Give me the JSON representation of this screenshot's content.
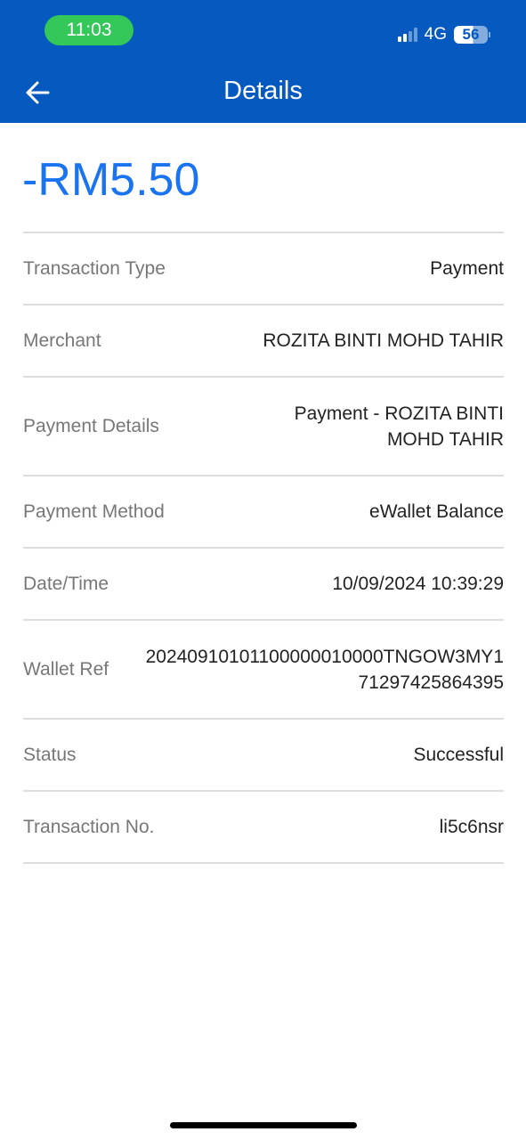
{
  "status_bar": {
    "time": "11:03",
    "network": "4G",
    "battery": "56"
  },
  "header": {
    "title": "Details",
    "back_icon": "arrow-left-icon"
  },
  "amount": "-RM5.50",
  "colors": {
    "header": "#0659bf",
    "amount": "#1a73f0",
    "time_pill": "#34c759"
  },
  "details": [
    {
      "label": "Transaction Type",
      "value": "Payment"
    },
    {
      "label": "Merchant",
      "value": "ROZITA BINTI MOHD TAHIR"
    },
    {
      "label": "Payment Details",
      "value": "Payment - ROZITA BINTI MOHD TAHIR"
    },
    {
      "label": "Payment Method",
      "value": "eWallet Balance"
    },
    {
      "label": "Date/Time",
      "value": "10/09/2024 10:39:29"
    },
    {
      "label": "Wallet Ref",
      "value": "20240910101100000010000TNGOW3MY171297425864395"
    },
    {
      "label": "Status",
      "value": "Successful"
    },
    {
      "label": "Transaction No.",
      "value": "li5c6nsr"
    }
  ]
}
